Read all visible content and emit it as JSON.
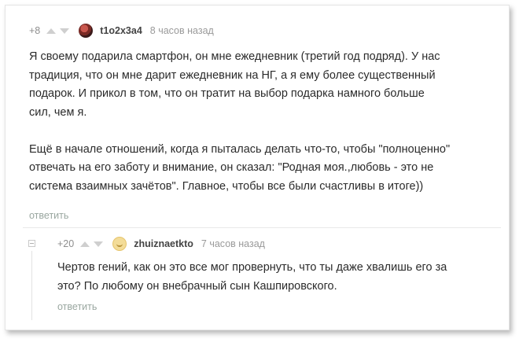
{
  "comments": [
    {
      "rating": "+8",
      "author": "t1o2x3a4",
      "time": "8 часов назад",
      "lines": [
        "Я своему подарила смартфон, он мне ежедневник (третий год подряд). У нас",
        "традиция, что он мне дарит ежедневник на НГ, а я ему более существенный",
        "подарок. И прикол в том, что он тратит на выбор подарка намного больше",
        "сил, чем я.",
        "",
        "Ещё в начале отношений, когда я пыталась делать что-то, чтобы \"полноценно\"",
        "отвечать на его заботу и внимание, он сказал: \"Родная моя.,любовь - это не",
        "система взаимных зачётов\". Главное, чтобы все были счастливы в итоге))"
      ],
      "reply_label": "ответить",
      "avatar_icon": "user-avatar-icon"
    },
    {
      "rating": "+20",
      "author": "zhuiznaetkto",
      "time": "7 часов назад",
      "lines": [
        "Чертов гений, как он это все мог провернуть, что ты даже хвалишь его за",
        "это? По любому он внебрачный сын Кашпировского."
      ],
      "reply_label": "ответить",
      "avatar_icon": "smiley-avatar-icon"
    }
  ],
  "colors": {
    "text": "#2b2b2b",
    "meta": "#8e8e8e",
    "reply_link": "#9aa7a0",
    "author": "#444444"
  }
}
